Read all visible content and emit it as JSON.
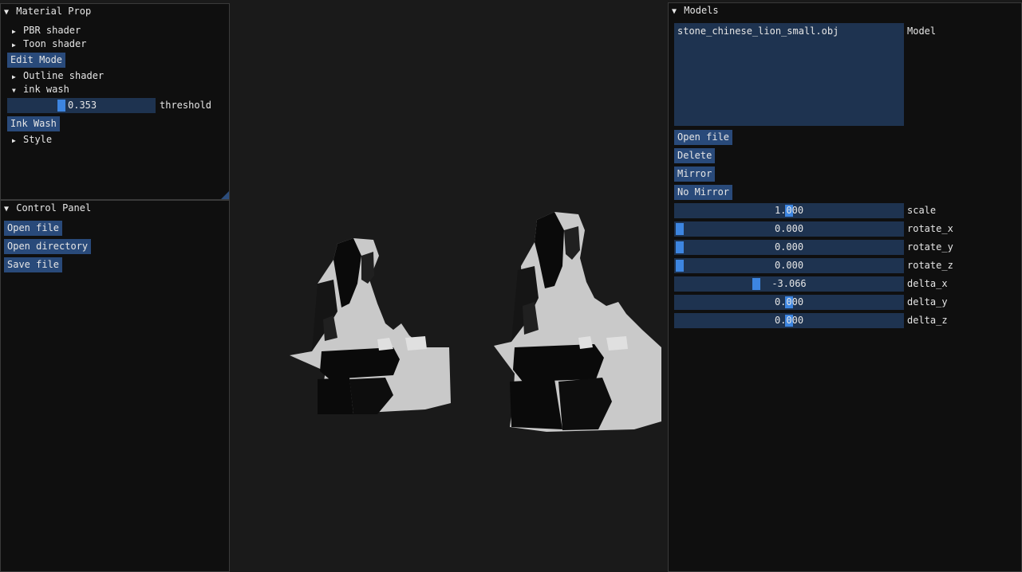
{
  "material_panel": {
    "title": "Material Prop",
    "items": [
      "PBR shader",
      "Toon shader"
    ],
    "edit_mode_label": "Edit Mode",
    "outline_label": "Outline shader",
    "ink_wash_label": "ink wash",
    "threshold": {
      "value_text": "0.353",
      "value": 0.353,
      "label": "threshold"
    },
    "ink_wash_button": "Ink Wash",
    "style_label": "Style"
  },
  "control_panel": {
    "title": "Control Panel",
    "open_file": "Open file",
    "open_directory": "Open directory",
    "save_file": "Save file"
  },
  "models_panel": {
    "title": "Models",
    "list_items": [
      "stone_chinese_lion_small.obj"
    ],
    "list_label": "Model",
    "open_file": "Open file",
    "delete": "Delete",
    "mirror": "Mirror",
    "no_mirror": "No Mirror",
    "params": [
      {
        "label": "scale",
        "value_text": "1.000",
        "fraction": 0.5
      },
      {
        "label": "rotate_x",
        "value_text": "0.000",
        "fraction": 0.0
      },
      {
        "label": "rotate_y",
        "value_text": "0.000",
        "fraction": 0.0
      },
      {
        "label": "rotate_z",
        "value_text": "0.000",
        "fraction": 0.0
      },
      {
        "label": "delta_x",
        "value_text": "-3.066",
        "fraction": 0.35
      },
      {
        "label": "delta_y",
        "value_text": "0.000",
        "fraction": 0.5
      },
      {
        "label": "delta_z",
        "value_text": "0.000",
        "fraction": 0.5
      }
    ]
  },
  "colors": {
    "accent": "#3d85e0",
    "button": "#294a7a",
    "frame": "#1e3350"
  },
  "viewport": {
    "model_name": "stone lion render"
  }
}
